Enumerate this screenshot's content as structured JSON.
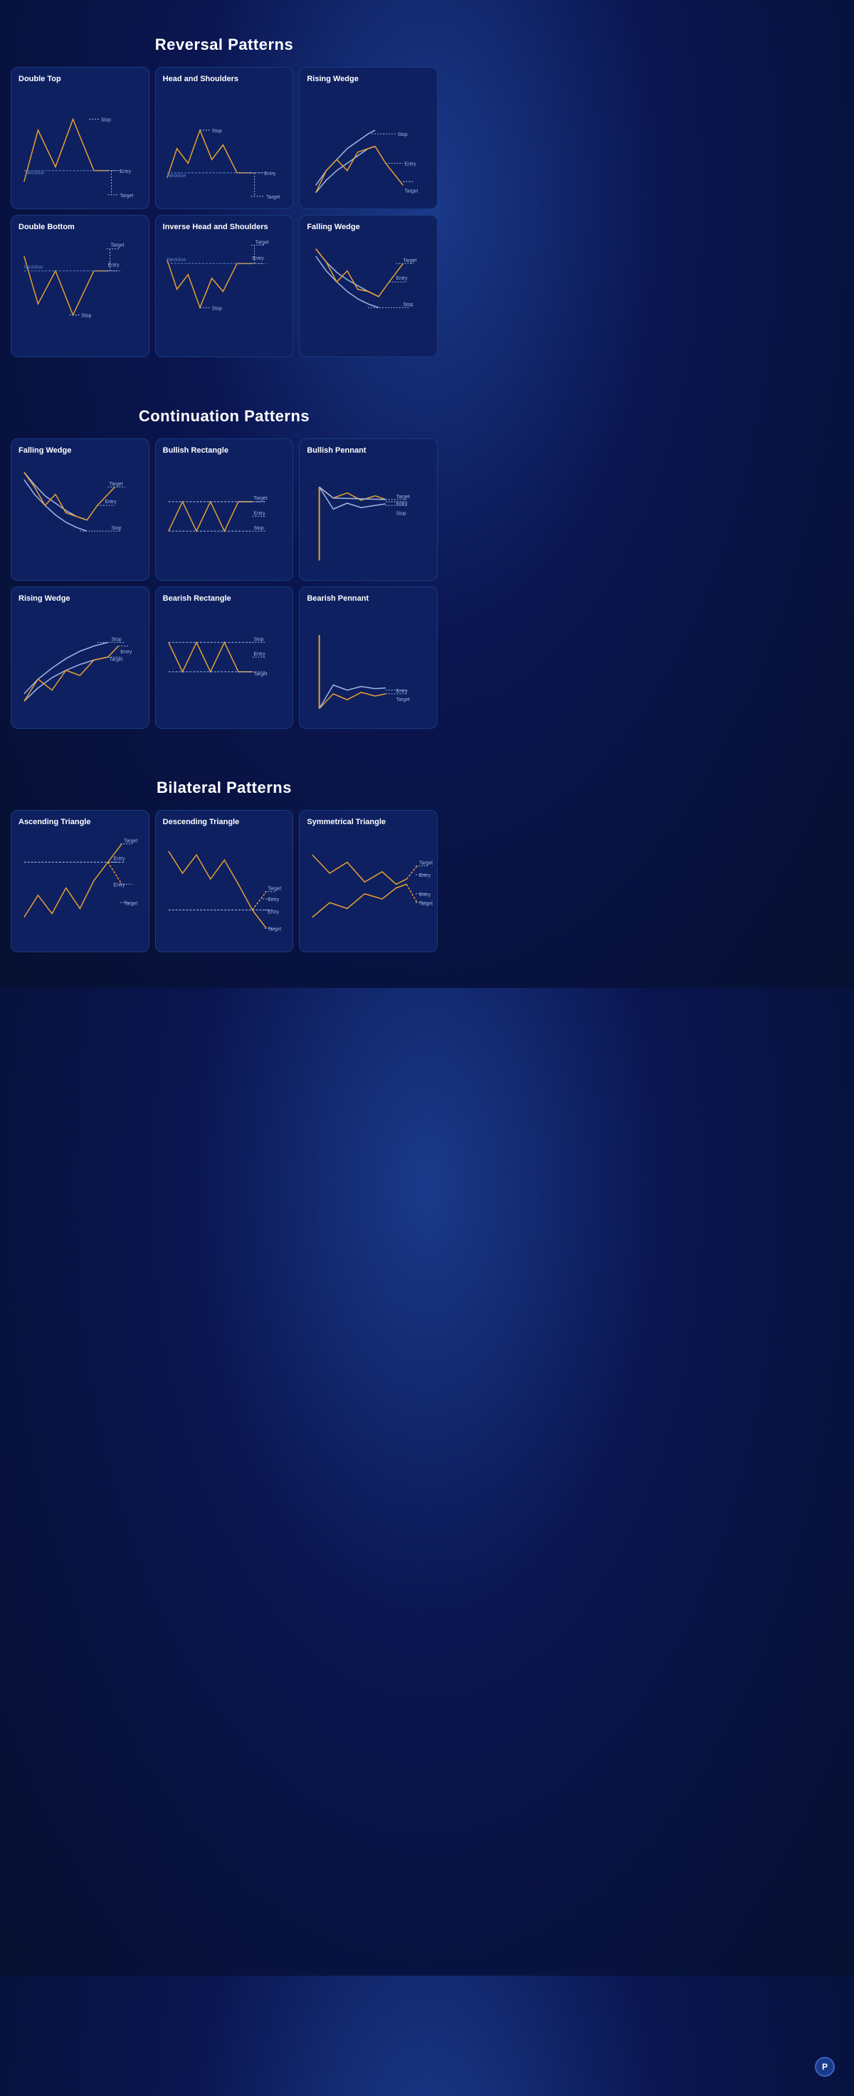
{
  "sections": [
    {
      "title": "Reversal Patterns",
      "cards": [
        {
          "name": "Double Top",
          "type": "double-top"
        },
        {
          "name": "Head and Shoulders",
          "type": "head-shoulders"
        },
        {
          "name": "Rising Wedge",
          "type": "rising-wedge-rev"
        },
        {
          "name": "Double Bottom",
          "type": "double-bottom"
        },
        {
          "name": "Inverse Head and Shoulders",
          "type": "inv-head-shoulders"
        },
        {
          "name": "Falling Wedge",
          "type": "falling-wedge-rev"
        }
      ]
    },
    {
      "title": "Continuation Patterns",
      "cards": [
        {
          "name": "Falling Wedge",
          "type": "falling-wedge-cont"
        },
        {
          "name": "Bullish Rectangle",
          "type": "bullish-rectangle"
        },
        {
          "name": "Bullish Pennant",
          "type": "bullish-pennant"
        },
        {
          "name": "Rising Wedge",
          "type": "rising-wedge-cont"
        },
        {
          "name": "Bearish Rectangle",
          "type": "bearish-rectangle"
        },
        {
          "name": "Bearish Pennant",
          "type": "bearish-pennant"
        }
      ]
    },
    {
      "title": "Bilateral Patterns",
      "cards": [
        {
          "name": "Ascending Triangle",
          "type": "ascending-triangle"
        },
        {
          "name": "Descending Triangle",
          "type": "descending-triangle"
        },
        {
          "name": "Symmetrical Triangle",
          "type": "symmetrical-triangle"
        }
      ]
    }
  ],
  "logo_text": "P"
}
